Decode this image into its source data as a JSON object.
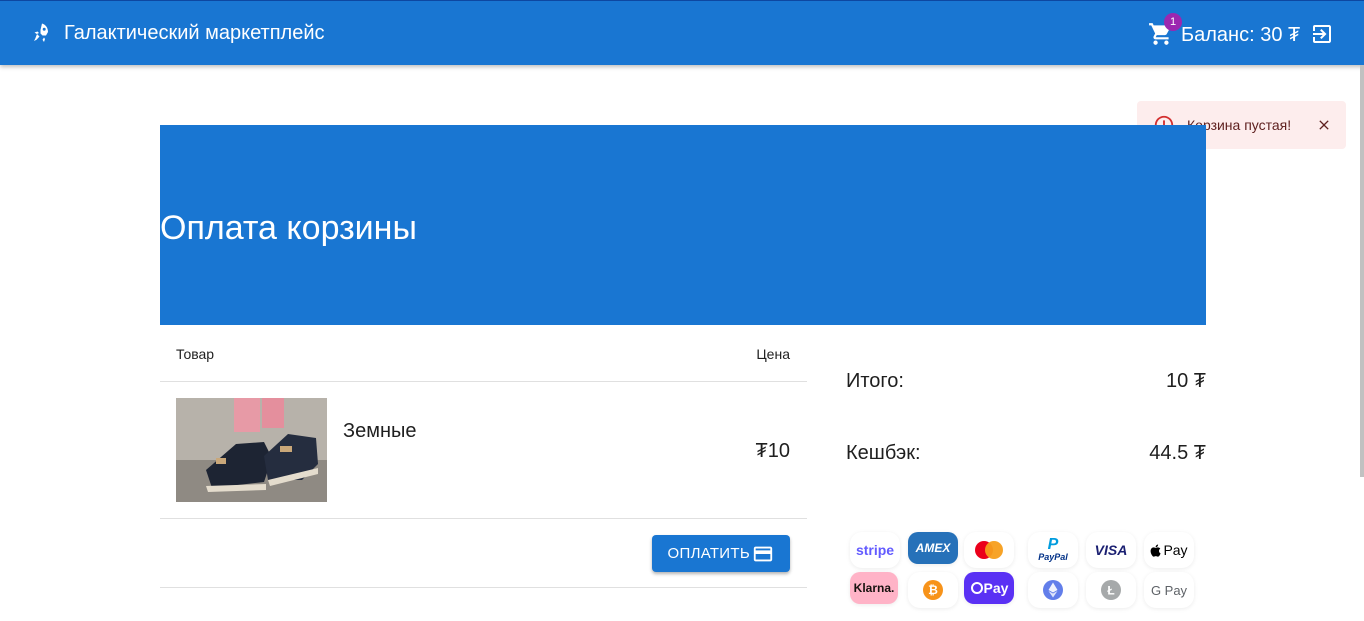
{
  "header": {
    "brand_icon": "rocket-icon",
    "title": "Галактический маркетплейс",
    "cart_count": "1",
    "balance": "Баланс: 30 ₮"
  },
  "toast": {
    "message": "Корзина пустая!",
    "color": "#fdeded"
  },
  "hero": {
    "title": "Оплата корзины",
    "color": "#1976d2"
  },
  "table": {
    "headers": {
      "product": "Товар",
      "price": "Цена"
    },
    "items": [
      {
        "name": "Земные",
        "price": "₮10"
      }
    ],
    "pay_button": "Оплатить"
  },
  "summary": {
    "total_label": "Итого:",
    "total_value": "10 ₮",
    "cashback_label": "Кешбэк:",
    "cashback_value": "44.5 ₮"
  },
  "payment_methods": {
    "row1": [
      "stripe",
      "AMEX",
      "",
      "PayPal",
      "VISA",
      "Pay"
    ],
    "row2": [
      "Klarna.",
      "",
      "Pay",
      "",
      "",
      "G Pay"
    ]
  }
}
